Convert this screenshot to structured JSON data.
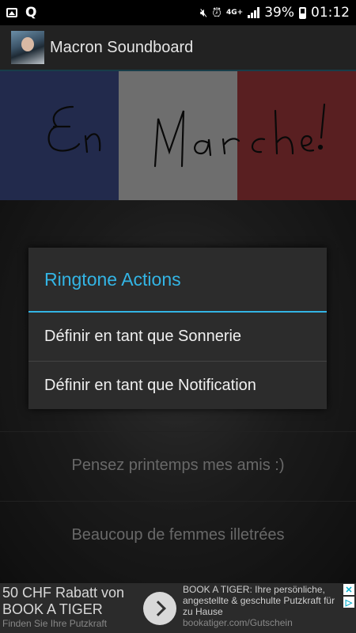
{
  "status_bar": {
    "network_label": "4G+",
    "battery_percent": "39%",
    "time": "01:12"
  },
  "app": {
    "title": "Macron Soundboard"
  },
  "banner": {
    "handwriting": "En Marche !"
  },
  "sound_list": {
    "items": [
      {
        "label": "Pensez printemps mes amis :)"
      },
      {
        "label": "Beaucoup de femmes illetrées"
      }
    ]
  },
  "dialog": {
    "title": "Ringtone Actions",
    "options": [
      {
        "label": "Définir en tant que Sonnerie"
      },
      {
        "label": "Définir en tant que Notification"
      }
    ]
  },
  "ad": {
    "headline": "50 CHF Rabatt von BOOK A TIGER",
    "sub": "Finden Sie Ihre Putzkraft",
    "body": "BOOK A TIGER: Ihre persönliche, angestellte & geschulte Putzkraft für zu Hause",
    "url": "bookatiger.com/Gutschein"
  },
  "colors": {
    "accent": "#33b5e5",
    "dialog_bg": "#2c2c2c",
    "actionbar_bg": "#222222",
    "flag_blue": "#3f4d8a",
    "flag_white": "#c9c9c9",
    "flag_red": "#a33a3d"
  }
}
